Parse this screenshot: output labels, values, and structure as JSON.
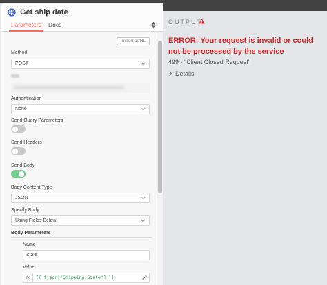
{
  "node": {
    "title": "Get ship date",
    "tabs": [
      {
        "label": "Parameters",
        "active": true
      },
      {
        "label": "Docs",
        "active": false
      }
    ],
    "import_label": "Import cURL"
  },
  "fields": {
    "method_label": "Method",
    "method_value": "POST",
    "url_label": "URL",
    "authentication_label": "Authentication",
    "authentication_value": "None",
    "send_query_label": "Send Query Parameters",
    "send_query_on": false,
    "send_headers_label": "Send Headers",
    "send_headers_on": false,
    "send_body_label": "Send Body",
    "send_body_on": true,
    "body_content_type_label": "Body Content Type",
    "body_content_type_value": "JSON",
    "specify_body_label": "Specify Body",
    "specify_body_value": "Using Fields Below"
  },
  "body_parameters": {
    "section_label": "Body Parameters",
    "name_label": "Name",
    "name_value": "state",
    "value_label": "Value",
    "fx_label": "fx",
    "value_expression": "{{ $json[\"Shipping State\"] }}"
  },
  "output": {
    "heading": "OUTPUT",
    "error_title": "ERROR: Your request is invalid or could not be processed by the service",
    "error_detail": "499 - \"Client Closed Request\"",
    "details_label": "Details"
  },
  "colors": {
    "accent": "#ff6d5a",
    "error": "#e0242a",
    "toggle_on": "#6fd18f",
    "expression": "#2a9d54"
  }
}
